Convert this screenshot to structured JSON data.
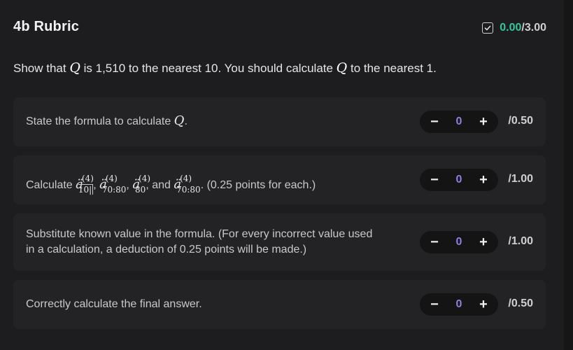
{
  "header": {
    "title": "4b Rubric",
    "score_value": "0.00",
    "score_max": "/3.00"
  },
  "prompt": {
    "part1": "Show that ",
    "var": "Q",
    "part2": " is 1,510 to the nearest 10. You should calculate ",
    "part3": " to the nearest 1."
  },
  "items": [
    {
      "text_before": "State the formula to calculate ",
      "math": "Q",
      "text_after": ".",
      "value": "0",
      "max": "/0.50"
    },
    {
      "prefix": "Calculate ",
      "terms": [
        {
          "base": "ä",
          "sup": "(4)",
          "sub": "10|"
        },
        {
          "base": "ä",
          "sup": "(4)",
          "sub": "70:80"
        },
        {
          "base": "ä",
          "sup": "(4)",
          "sub": "80"
        },
        {
          "base": "ä",
          "sup": "(4)",
          "sub": "70:80"
        }
      ],
      "sep1": ", ",
      "sep2": ", ",
      "sep3": ", and ",
      "suffix": ". (0.25 points for each.)",
      "value": "0",
      "max": "/1.00"
    },
    {
      "line1": "Substitute known value in the formula. (For every incorrect value used",
      "line2": "in a calculation, a deduction of 0.25 points will be made.)",
      "value": "0",
      "max": "/1.00"
    },
    {
      "text": "Correctly calculate the final answer.",
      "value": "0",
      "max": "/0.50"
    }
  ],
  "stepper": {
    "minus": "−",
    "plus": "+"
  },
  "colors": {
    "score_accent": "#34c79a",
    "stepper_value": "#8f7fe0"
  },
  "icons": {
    "graded": "checkbox-check-icon"
  }
}
